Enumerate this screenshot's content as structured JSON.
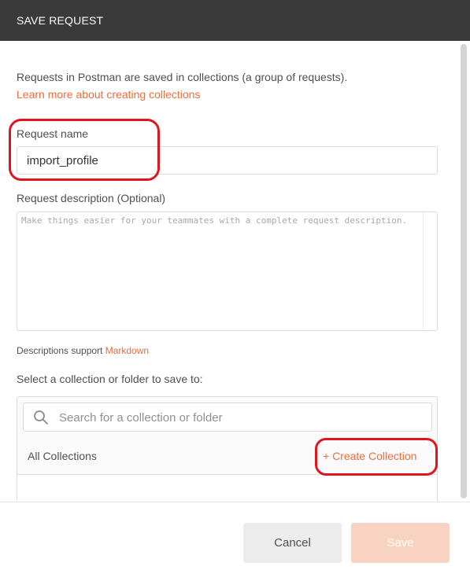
{
  "dialog": {
    "title": "SAVE REQUEST"
  },
  "intro": {
    "text": "Requests in Postman are saved in collections (a group of requests).",
    "learn_link": "Learn more about creating collections"
  },
  "request_name": {
    "label": "Request name",
    "value": "import_profile"
  },
  "request_description": {
    "label": "Request description (Optional)",
    "placeholder": "Make things easier for your teammates with a complete request description."
  },
  "markdown_note": {
    "text": "Descriptions support ",
    "link": "Markdown"
  },
  "collections": {
    "label": "Select a collection or folder to save to:",
    "search_placeholder": "Search for a collection or folder",
    "all_collections": "All Collections",
    "create_collection": "+ Create Collection"
  },
  "footer": {
    "cancel_label": "Cancel",
    "save_label": "Save"
  },
  "icons": {
    "search": "search-icon"
  },
  "colors": {
    "header_bg": "#3a3a3a",
    "link": "#f26b3a",
    "save_disabled": "#f9d3c2",
    "annotation": "#e0151f"
  }
}
